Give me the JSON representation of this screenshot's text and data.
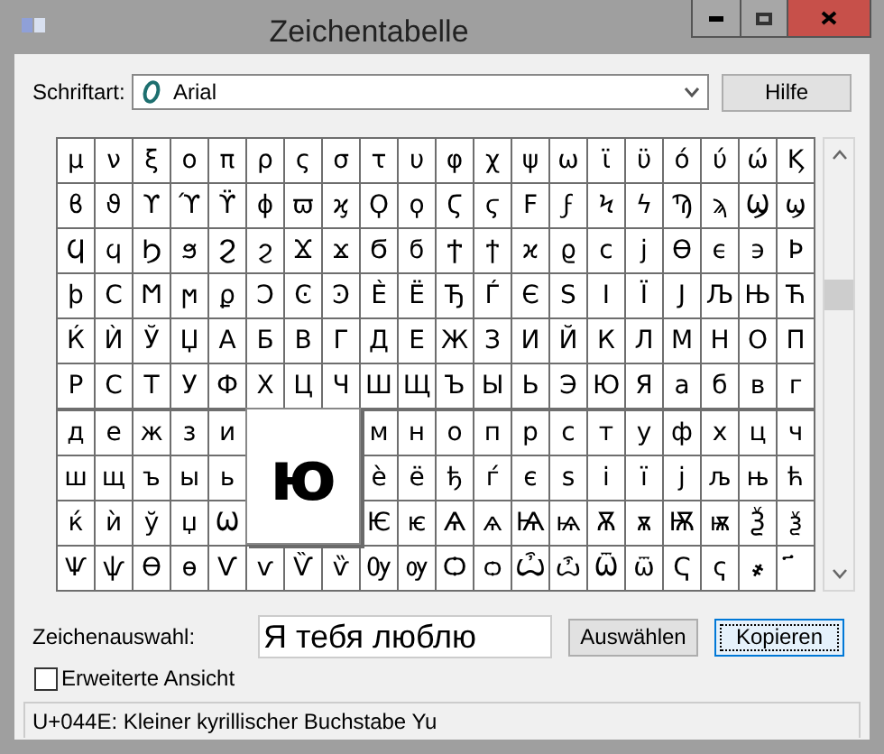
{
  "window": {
    "title": "Zeichentabelle"
  },
  "font_field": {
    "label": "Schriftart:",
    "value": "Arial"
  },
  "help_button": {
    "label": "Hilfe"
  },
  "grid": {
    "rows": [
      [
        "μ",
        "ν",
        "ξ",
        "ο",
        "π",
        "ρ",
        "ς",
        "σ",
        "τ",
        "υ",
        "φ",
        "χ",
        "ψ",
        "ω",
        "ϊ",
        "ϋ",
        "ό",
        "ύ",
        "ώ",
        "Ϗ"
      ],
      [
        "ϐ",
        "ϑ",
        "ϒ",
        "ϓ",
        "ϔ",
        "ϕ",
        "ϖ",
        "ϗ",
        "Ϙ",
        "ϙ",
        "Ϛ",
        "ϛ",
        "Ϝ",
        "ϝ",
        "Ϟ",
        "ϟ",
        "Ϡ",
        "ϡ",
        "Ϣ",
        "ϣ"
      ],
      [
        "Ϥ",
        "ϥ",
        "Ϧ",
        "ϧ",
        "Ϩ",
        "ϩ",
        "Ϫ",
        "ϫ",
        "Ϭ",
        "ϭ",
        "Ϯ",
        "ϯ",
        "ϰ",
        "ϱ",
        "ϲ",
        "ϳ",
        "ϴ",
        "ϵ",
        "϶",
        "Ϸ"
      ],
      [
        "ϸ",
        "Ϲ",
        "Ϻ",
        "ϻ",
        "ϼ",
        "Ͻ",
        "Ͼ",
        "Ͽ",
        "Ѐ",
        "Ё",
        "Ђ",
        "Ѓ",
        "Є",
        "Ѕ",
        "І",
        "Ї",
        "Ј",
        "Љ",
        "Њ",
        "Ћ"
      ],
      [
        "Ќ",
        "Ѝ",
        "Ў",
        "Џ",
        "А",
        "Б",
        "В",
        "Г",
        "Д",
        "Е",
        "Ж",
        "З",
        "И",
        "Й",
        "К",
        "Л",
        "М",
        "Н",
        "О",
        "П"
      ],
      [
        "Р",
        "С",
        "Т",
        "У",
        "Ф",
        "Х",
        "Ц",
        "Ч",
        "Ш",
        "Щ",
        "Ъ",
        "Ы",
        "Ь",
        "Э",
        "Ю",
        "Я",
        "а",
        "б",
        "в",
        "г"
      ],
      [
        "д",
        "е",
        "ж",
        "з",
        "и",
        null,
        null,
        null,
        "м",
        "н",
        "о",
        "п",
        "р",
        "с",
        "т",
        "у",
        "ф",
        "х",
        "ц",
        "ч"
      ],
      [
        "ш",
        "щ",
        "ъ",
        "ы",
        "ь",
        null,
        null,
        null,
        "ѐ",
        "ё",
        "ђ",
        "ѓ",
        "є",
        "ѕ",
        "і",
        "ї",
        "ј",
        "љ",
        "њ",
        "ћ"
      ],
      [
        "ќ",
        "ѝ",
        "ў",
        "џ",
        "Ѡ",
        null,
        null,
        null,
        "Ѥ",
        "ѥ",
        "Ѧ",
        "ѧ",
        "Ѩ",
        "ѩ",
        "Ѫ",
        "ѫ",
        "Ѭ",
        "ѭ",
        "Ѯ",
        "ѯ"
      ],
      [
        "Ѱ",
        "ѱ",
        "Ѳ",
        "ѳ",
        "Ѵ",
        "ѵ",
        "Ѷ",
        "ѷ",
        "Ѹ",
        "ѹ",
        "Ѻ",
        "ѻ",
        "Ѽ",
        "ѽ",
        "Ѿ",
        "ѿ",
        "Ҁ",
        "ҁ",
        "҂",
        "҃"
      ]
    ]
  },
  "magnified_char": "ю",
  "selection": {
    "label": "Zeichenauswahl:",
    "value": "Я тебя люблю"
  },
  "buttons": [
    {
      "label": "Auswählen",
      "focused": false
    },
    {
      "label": "Kopieren",
      "focused": true
    }
  ],
  "advanced_view": {
    "label": "Erweiterte Ansicht",
    "checked": false
  },
  "status_bar": "U+044E: Kleiner kyrillischer Buchstabe Yu"
}
